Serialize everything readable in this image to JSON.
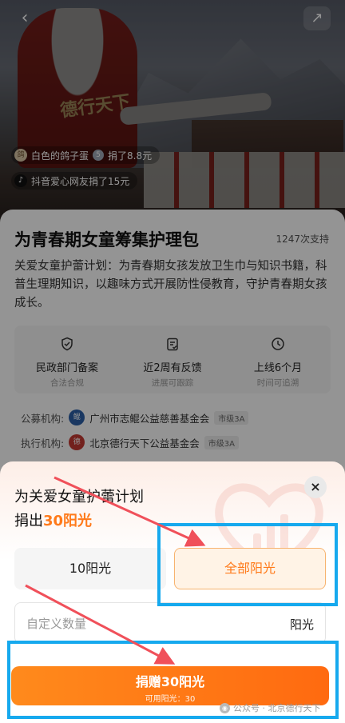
{
  "hero": {
    "vest_text": "德行天下",
    "donors": [
      {
        "name": "白色的鸽子蛋",
        "action": "捐了8.8元"
      },
      {
        "name": "抖音爱心网友捐了15元"
      }
    ]
  },
  "project": {
    "title": "为青春期女童筹集护理包",
    "supporters": "1247次支持",
    "description": "关爱女童护蕾计划：为青春期女孩发放卫生巾与知识书籍，科普生理期知识，以趣味方式开展防性侵教育，守护青春期女孩成长。",
    "features": [
      {
        "icon": "shield-check-icon",
        "title": "民政部门备案",
        "sub": "合法合规"
      },
      {
        "icon": "clipboard-icon",
        "title": "近2周有反馈",
        "sub": "进展可跟踪"
      },
      {
        "icon": "clock-icon",
        "title": "上线6个月",
        "sub": "时间可追溯"
      }
    ],
    "orgs": [
      {
        "label": "公募机构:",
        "name": "广州市志鲲公益慈善基金会",
        "level": "市级3A"
      },
      {
        "label": "执行机构:",
        "name": "北京德行天下公益基金会",
        "level": "市级3A"
      }
    ]
  },
  "sheet": {
    "title": "为关爱女童护蕾计划",
    "sub_prefix": "捐出",
    "sub_amount": "30阳光",
    "option_1": "10阳光",
    "option_2": "全部阳光",
    "custom_placeholder": "自定义数量",
    "custom_unit": "阳光",
    "donate_label": "捐赠30阳光",
    "available": "可用阳光：30",
    "close_icon": "×"
  },
  "watermark": "公众号 · 北京德行天下",
  "colors": {
    "accent": "#ff7a1a",
    "highlight": "#16a9ee",
    "arrow": "#f0505a"
  }
}
